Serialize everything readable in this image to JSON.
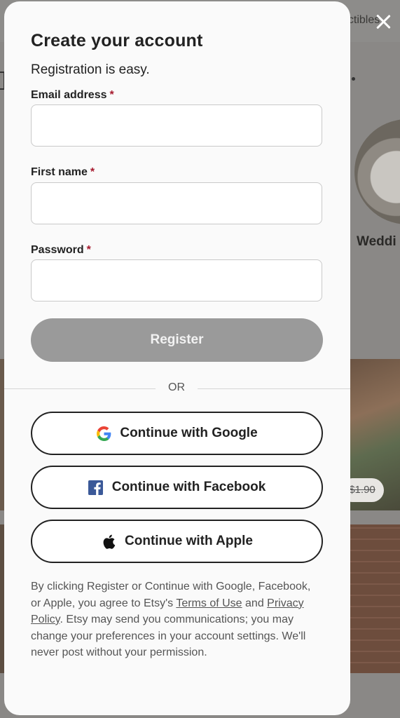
{
  "background": {
    "nav_text": "ectibles",
    "category_label": "Weddi",
    "price": "$1.90"
  },
  "modal": {
    "title": "Create your account",
    "subtitle": "Registration is easy.",
    "required_marker": "*",
    "fields": {
      "email_label": "Email address",
      "first_name_label": "First name",
      "password_label": "Password",
      "email_value": "",
      "first_name_value": "",
      "password_value": ""
    },
    "register_label": "Register",
    "or_label": "OR",
    "social": {
      "google_label": "Continue with Google",
      "facebook_label": "Continue with Facebook",
      "apple_label": "Continue with Apple"
    },
    "legal": {
      "part1": "By clicking Register or Continue with Google, Facebook, or Apple, you agree to Etsy's ",
      "terms_link": "Terms of Use",
      "part2": " and ",
      "privacy_link": "Privacy Policy",
      "part3": ". Etsy may send you communications; you may change your preferences in your account settings. We'll never post without your permission."
    }
  },
  "colors": {
    "register_disabled": "#9a9a9a",
    "required_marker": "#a61a2e",
    "facebook_blue": "#3b5998"
  }
}
